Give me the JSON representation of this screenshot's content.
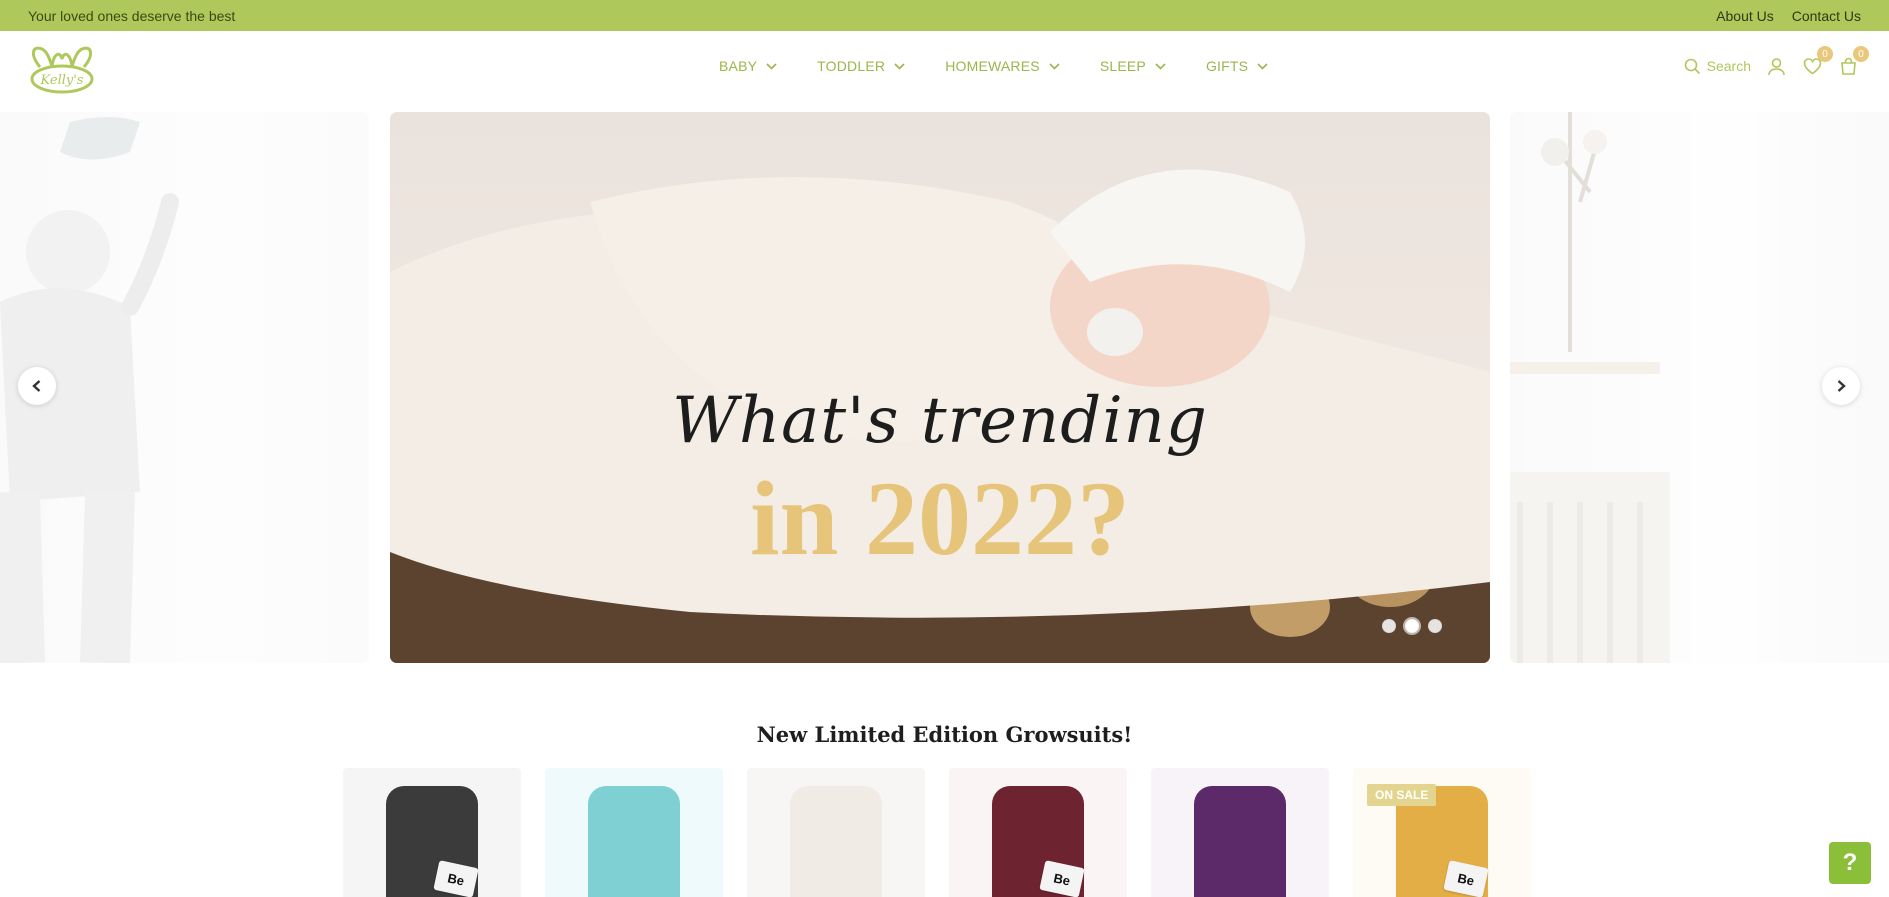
{
  "topbar": {
    "tagline": "Your loved ones deserve the best",
    "links": [
      "About Us",
      "Contact Us"
    ]
  },
  "header": {
    "logo_text": "Kelly's",
    "nav": [
      "BABY",
      "TODDLER",
      "HOMEWARES",
      "SLEEP",
      "GIFTS"
    ],
    "search_label": "Search",
    "wishlist_count": "0",
    "cart_count": "0"
  },
  "hero": {
    "line1": "What's trending",
    "line2": "in 2022?",
    "slide_count": 3,
    "active_slide": 2
  },
  "products_section": {
    "title": "New Limited Edition Growsuits!",
    "sale_badge": "ON SALE",
    "tag_label": "Be"
  },
  "help_button": "?",
  "colors": {
    "brand_green": "#afc85b",
    "gold": "#e6c57b"
  }
}
